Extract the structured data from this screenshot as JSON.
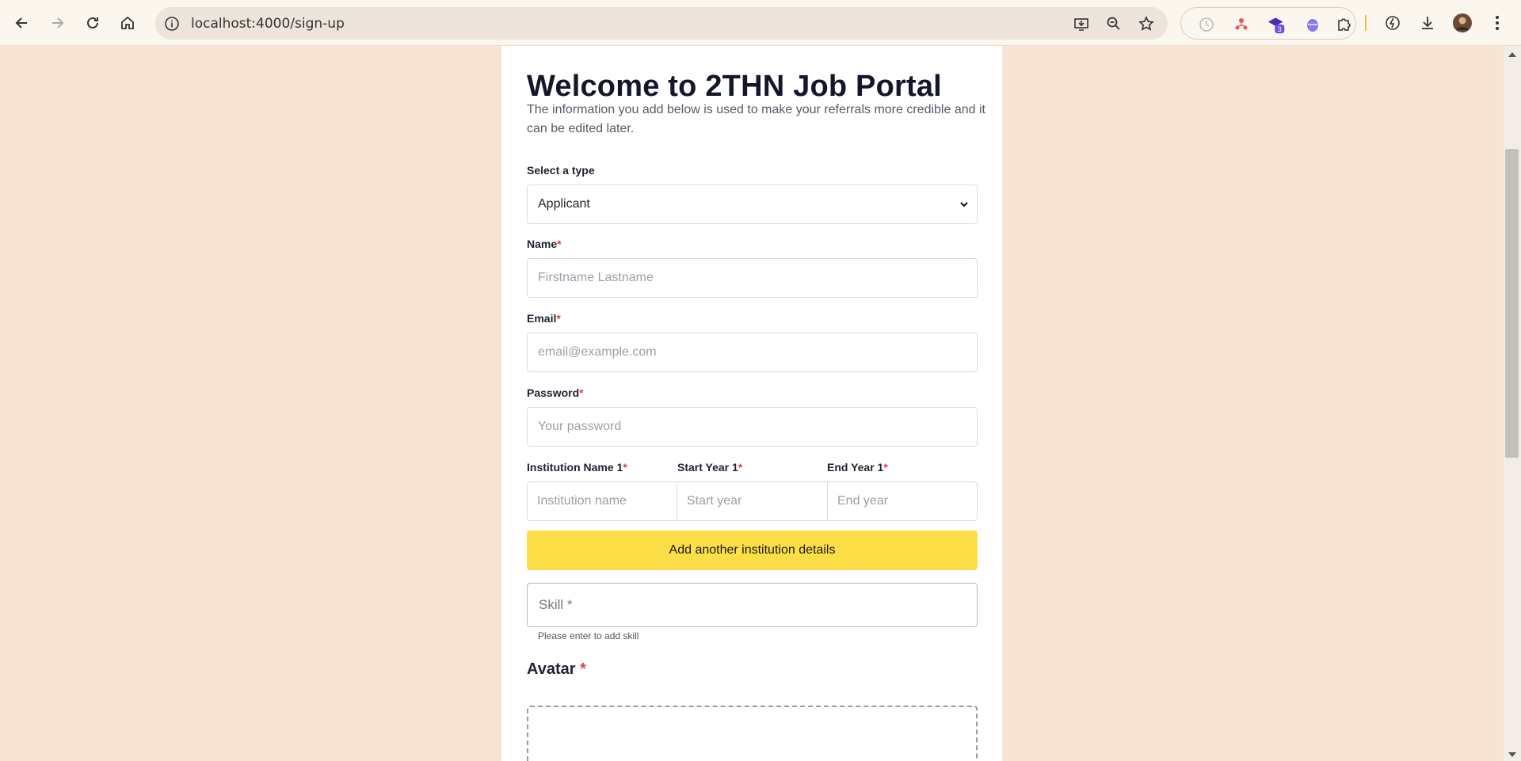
{
  "browser": {
    "url": "localhost:4000/sign-up",
    "extension_badge": "3"
  },
  "page": {
    "title": "Welcome to 2THN Job Portal",
    "subtitle": "The information you add below is used to make your referrals more credible and it can be edited later."
  },
  "form": {
    "type_label": "Select a type",
    "type_value": "Applicant",
    "name_label": "Name",
    "name_placeholder": "Firstname Lastname",
    "email_label": "Email",
    "email_placeholder": "email@example.com",
    "password_label": "Password",
    "password_placeholder": "Your password",
    "institution_label": "Institution Name 1",
    "institution_placeholder": "Institution name",
    "start_label": "Start Year 1",
    "start_placeholder": "Start year",
    "end_label": "End Year 1",
    "end_placeholder": "End year",
    "required_mark": "*",
    "add_institution_button": "Add another institution details",
    "skill_placeholder": "Skill *",
    "skill_helper": "Please enter to add skill",
    "avatar_label": "Avatar"
  },
  "colors": {
    "page_bg": "#f7e4d2",
    "accent_button": "#fcdf47",
    "required": "#e53e3e"
  }
}
